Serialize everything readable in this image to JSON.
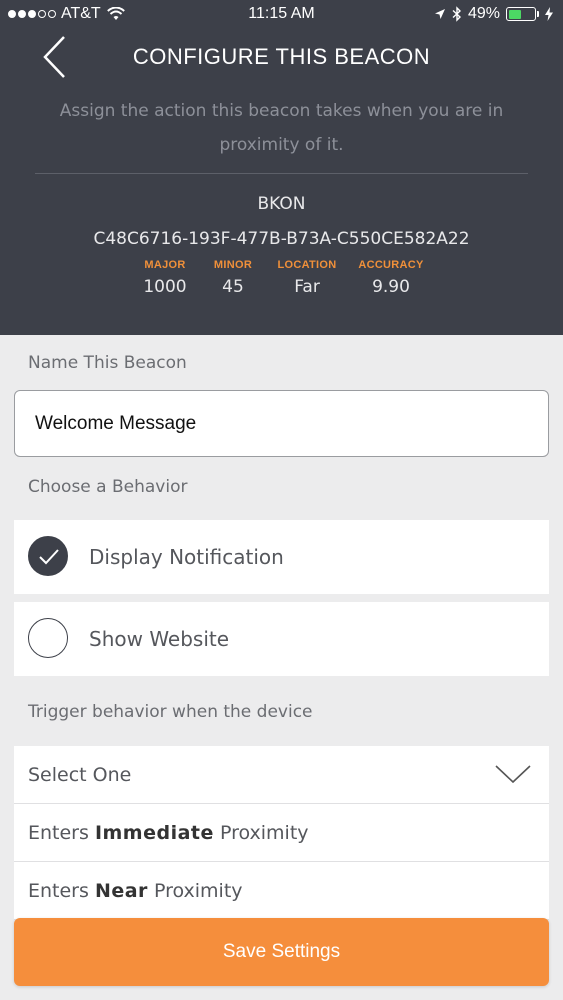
{
  "status_bar": {
    "carrier": "AT&T",
    "time": "11:15 AM",
    "battery": "49%",
    "battery_level": 0.49
  },
  "header": {
    "title": "CONFIGURE THIS BEACON",
    "subtitle": "Assign the action this beacon takes when you are in proximity of it."
  },
  "beacon": {
    "name": "BKON",
    "uuid": "C48C6716-193F-477B-B73A-C550CE582A22",
    "stats": [
      {
        "label": "MAJOR",
        "value": "1000"
      },
      {
        "label": "MINOR",
        "value": "45"
      },
      {
        "label": "LOCATION",
        "value": "Far"
      },
      {
        "label": "ACCURACY",
        "value": "9.90"
      }
    ]
  },
  "form": {
    "name_label": "Name This Beacon",
    "name_value": "Welcome Message",
    "behavior_label": "Choose a Behavior",
    "behaviors": [
      {
        "label": "Display Notification",
        "selected": true
      },
      {
        "label": "Show Website",
        "selected": false
      }
    ],
    "trigger_label": "Trigger behavior when the device",
    "trigger_select": "Select One",
    "trigger_options": [
      {
        "prefix": "Enters ",
        "bold": "Immediate",
        "suffix": " Proximity"
      },
      {
        "prefix": "Enters ",
        "bold": "Near",
        "suffix": " Proximity"
      }
    ],
    "save_label": "Save Settings"
  },
  "colors": {
    "header_bg": "#3d4049",
    "accent_orange": "#f58e3c",
    "battery_green": "#4cd964"
  }
}
